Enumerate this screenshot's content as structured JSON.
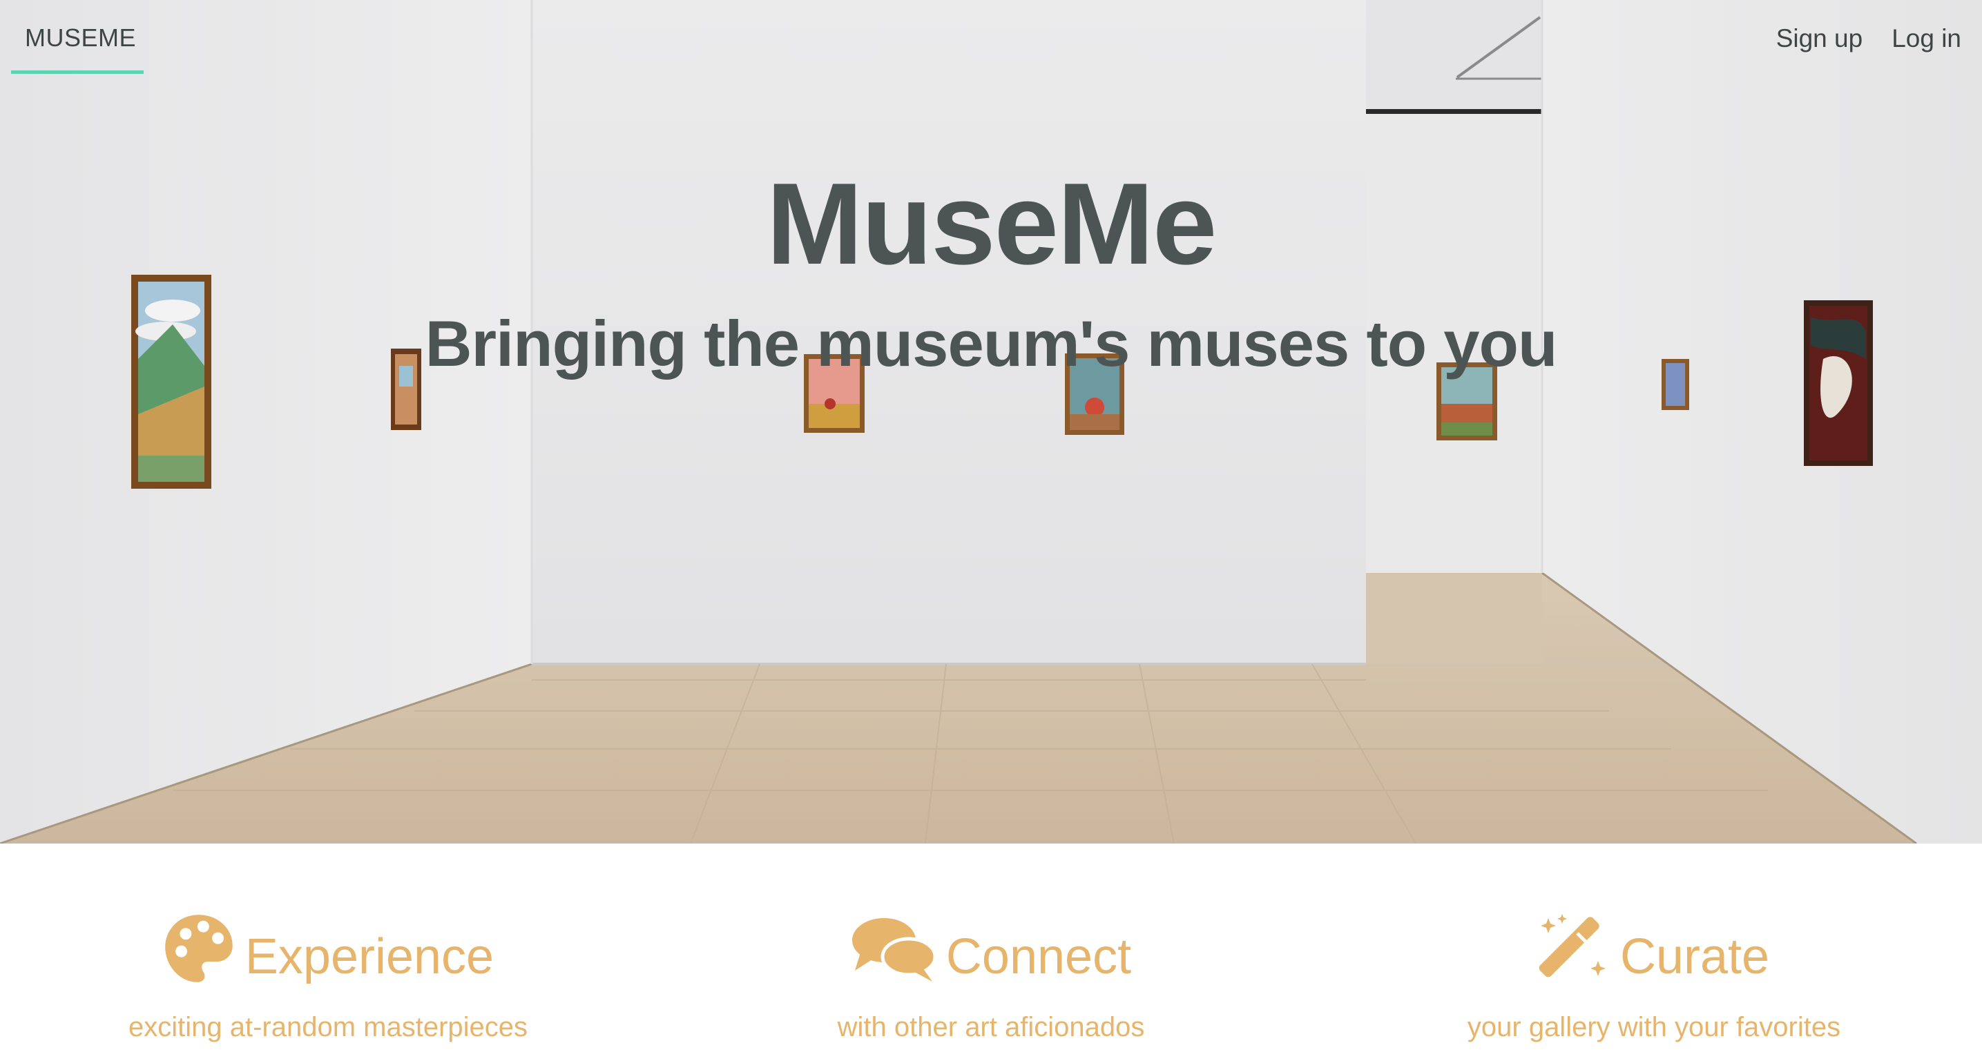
{
  "nav": {
    "brand": "MUSEME",
    "signup": "Sign up",
    "login": "Log in"
  },
  "hero": {
    "title": "MuseMe",
    "subtitle": "Bringing the museum's muses to you"
  },
  "features": [
    {
      "icon": "palette-icon",
      "title": "Experience",
      "description": "exciting at-random masterpieces"
    },
    {
      "icon": "comments-icon",
      "title": "Connect",
      "description": "with other art aficionados"
    },
    {
      "icon": "magic-wand-icon",
      "title": "Curate",
      "description": "your gallery with your favorites"
    }
  ],
  "colors": {
    "accent": "#5fd3b0",
    "feature": "#e6b56b",
    "text": "#4c5454"
  }
}
